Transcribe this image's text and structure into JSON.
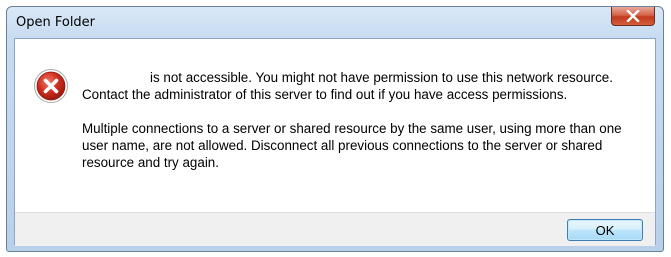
{
  "dialog": {
    "title": "Open Folder",
    "close_icon": "close-x-icon",
    "error_icon": "error-icon",
    "message_line1": "is not accessible. You might not have permission to use this network resource. Contact the administrator of this server to find out if you have access permissions.",
    "message_line2": "Multiple connections to a server or shared resource by the same user, using more than one user name, are not allowed. Disconnect all previous connections to the server or shared resource and try again.",
    "ok_label": "OK"
  },
  "colors": {
    "close_button": "#c13a1f",
    "ok_border": "#3c7fb1",
    "title_bar": "#c8dcf1"
  }
}
